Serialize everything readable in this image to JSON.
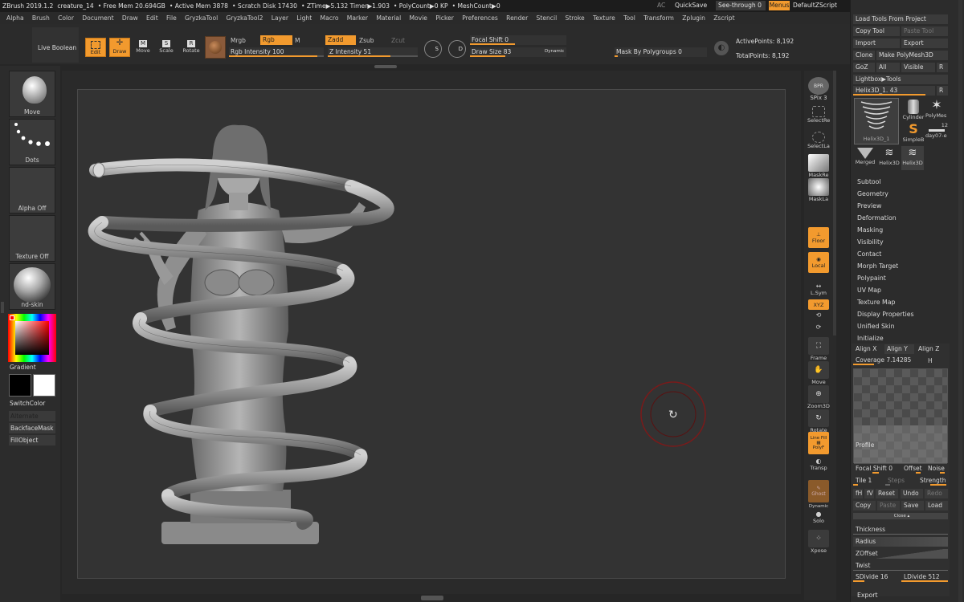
{
  "titlebar": {
    "app": "ZBrush 2019.1.2",
    "file": "creature_14",
    "free_mem": "• Free Mem 20.694GB",
    "active_mem": "• Active Mem 3878",
    "scratch": "• Scratch Disk 17430",
    "ztime": "• ZTime▶5.132 Timer▶1.903",
    "polycount": "• PolyCount▶0 KP",
    "meshcount": "• MeshCount▶0",
    "ac": "AC",
    "quicksave": "QuickSave",
    "see_through": "See-through  0",
    "menus": "Menus",
    "default_zscript": "DefaultZScript"
  },
  "menubar": [
    "Alpha",
    "Brush",
    "Color",
    "Document",
    "Draw",
    "Edit",
    "File",
    "GryzkaTool",
    "GryzkaTool2",
    "Layer",
    "Light",
    "Macro",
    "Marker",
    "Material",
    "Movie",
    "Picker",
    "Preferences",
    "Render",
    "Stencil",
    "Stroke",
    "Texture",
    "Tool",
    "Transform",
    "Zplugin",
    "Zscript"
  ],
  "shelf": {
    "live_boolean": "Live Boolean",
    "edit": "Edit",
    "draw": "Draw",
    "move": "Move",
    "scale": "Scale",
    "rotate": "Rotate",
    "mrgb": "Mrgb",
    "rgb": "Rgb",
    "m": "M",
    "rgb_intensity": "Rgb Intensity 100",
    "zadd": "Zadd",
    "zsub": "Zsub",
    "zcut": "Zcut",
    "z_intensity": "Z Intensity 51",
    "s_label": "S",
    "d_label": "D",
    "focal_shift": "Focal Shift 0",
    "draw_size": "Draw Size 83",
    "dynamic": "Dynamic",
    "mask_by_polygroups": "Mask By Polygroups 0",
    "active_points": "ActivePoints: 8,192",
    "total_points": "TotalPoints: 8,192"
  },
  "left": {
    "brush": "Move",
    "stroke": "Dots",
    "alpha": "Alpha Off",
    "texture": "Texture Off",
    "material": "nd-skin",
    "gradient": "Gradient",
    "switch_color": "SwitchColor",
    "alternate": "Alternate",
    "backface_mask": "BackfaceMask",
    "fill_object": "FillObject"
  },
  "righttools": {
    "bpr": "BPR",
    "spix": "SPix 3",
    "select_rect": "SelectRe",
    "select_lasso": "SelectLa",
    "mask_rect": "MaskRe",
    "mask_lasso": "MaskLa",
    "floor": "Floor",
    "local": "Local",
    "lsym": "L.Sym",
    "xyz": "XYZ",
    "frame": "Frame",
    "move": "Move",
    "zoom3d": "Zoom3D",
    "rotate": "Rotate",
    "line_fill": "Line Fill",
    "polyf": "PolyF",
    "transp": "Transp",
    "ghost": "Ghost",
    "dynamic": "Dynamic",
    "solo": "Solo",
    "xpose": "Xpose"
  },
  "tool": {
    "load_tools": "Load Tools From Project",
    "copy_tool": "Copy Tool",
    "paste_tool": "Paste Tool",
    "import": "Import",
    "export": "Export",
    "clone": "Clone",
    "make_polymesh": "Make PolyMesh3D",
    "goz": "GoZ",
    "all": "All",
    "visible": "Visible",
    "r": "R",
    "lightbox": "Lightbox▶Tools",
    "current_tool": "Helix3D_1. 43",
    "thumbs": [
      "Helix3D_1",
      "Cylinder",
      "PolyMes",
      "SimpleB",
      "day07-e",
      "Merged",
      "Helix3D",
      "Helix3D"
    ],
    "count": "12",
    "sections": [
      "Subtool",
      "Geometry",
      "Preview",
      "Deformation",
      "Masking",
      "Visibility",
      "Contact",
      "Morph Target",
      "Polypaint",
      "UV Map",
      "Texture Map",
      "Display Properties",
      "Unified Skin",
      "Initialize"
    ],
    "align_x": "Align X",
    "align_y": "Align Y",
    "align_z": "Align Z",
    "coverage": "Coverage 7.14285",
    "h": "H",
    "profile": "Profile",
    "focal_shift": "Focal Shift 0",
    "offset": "Offset",
    "noise": "Noise",
    "tile": "Tile 1",
    "steps": "Steps",
    "strength": "Strength",
    "fh": "fH",
    "fv": "fV",
    "reset": "Reset",
    "undo": "Undo",
    "redo": "Redo",
    "copy": "Copy",
    "paste": "Paste",
    "save": "Save",
    "load": "Load",
    "close": "Close ▴",
    "thickness": "Thickness",
    "radius": "Radius",
    "zoffset": "ZOffset",
    "twist": "Twist",
    "sdivide": "SDivide 16",
    "ldivide": "LDivide 512",
    "export_section": "Export"
  }
}
